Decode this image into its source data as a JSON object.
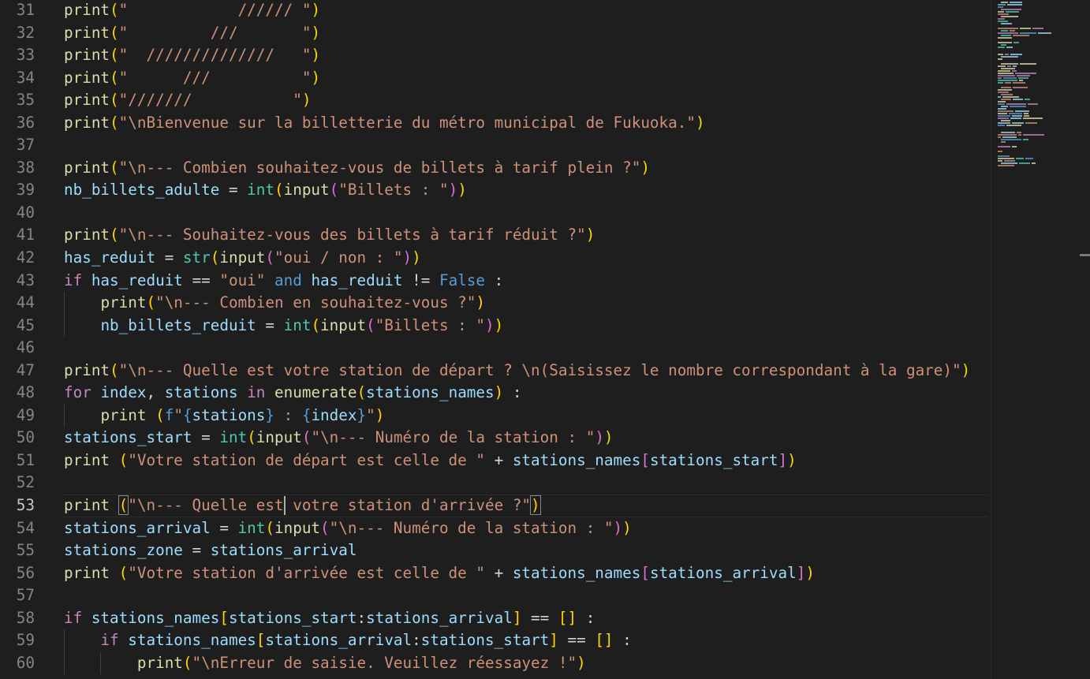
{
  "editor": {
    "current_line": 53,
    "lines": [
      {
        "n": "31",
        "tokens": [
          [
            "fn",
            "print"
          ],
          [
            "b1",
            "("
          ],
          [
            "str",
            "\"            ////// \""
          ],
          [
            "b1",
            ")"
          ]
        ]
      },
      {
        "n": "32",
        "tokens": [
          [
            "fn",
            "print"
          ],
          [
            "b1",
            "("
          ],
          [
            "str",
            "\"         ///       \""
          ],
          [
            "b1",
            ")"
          ]
        ]
      },
      {
        "n": "33",
        "tokens": [
          [
            "fn",
            "print"
          ],
          [
            "b1",
            "("
          ],
          [
            "str",
            "\"  //////////////   \""
          ],
          [
            "b1",
            ")"
          ]
        ]
      },
      {
        "n": "34",
        "tokens": [
          [
            "fn",
            "print"
          ],
          [
            "b1",
            "("
          ],
          [
            "str",
            "\"      ///          \""
          ],
          [
            "b1",
            ")"
          ]
        ]
      },
      {
        "n": "35",
        "tokens": [
          [
            "fn",
            "print"
          ],
          [
            "b1",
            "("
          ],
          [
            "str",
            "\"///////           \""
          ],
          [
            "b1",
            ")"
          ]
        ]
      },
      {
        "n": "36",
        "tokens": [
          [
            "fn",
            "print"
          ],
          [
            "b1",
            "("
          ],
          [
            "str",
            "\"\\nBienvenue sur la billetterie du métro municipal de Fukuoka.\""
          ],
          [
            "b1",
            ")"
          ]
        ]
      },
      {
        "n": "37",
        "tokens": []
      },
      {
        "n": "38",
        "tokens": [
          [
            "fn",
            "print"
          ],
          [
            "b1",
            "("
          ],
          [
            "str",
            "\"\\n--- Combien souhaitez-vous de billets à tarif plein ?\""
          ],
          [
            "b1",
            ")"
          ]
        ]
      },
      {
        "n": "39",
        "tokens": [
          [
            "var",
            "nb_billets_adulte"
          ],
          [
            "op",
            " = "
          ],
          [
            "type",
            "int"
          ],
          [
            "b1",
            "("
          ],
          [
            "fn",
            "input"
          ],
          [
            "b2",
            "("
          ],
          [
            "str",
            "\"Billets : \""
          ],
          [
            "b2",
            ")"
          ],
          [
            "b1",
            ")"
          ]
        ]
      },
      {
        "n": "40",
        "tokens": []
      },
      {
        "n": "41",
        "tokens": [
          [
            "fn",
            "print"
          ],
          [
            "b1",
            "("
          ],
          [
            "str",
            "\"\\n--- Souhaitez-vous des billets à tarif réduit ?\""
          ],
          [
            "b1",
            ")"
          ]
        ]
      },
      {
        "n": "42",
        "tokens": [
          [
            "var",
            "has_reduit"
          ],
          [
            "op",
            " = "
          ],
          [
            "type",
            "str"
          ],
          [
            "b1",
            "("
          ],
          [
            "fn",
            "input"
          ],
          [
            "b2",
            "("
          ],
          [
            "str",
            "\"oui / non : \""
          ],
          [
            "b2",
            ")"
          ],
          [
            "b1",
            ")"
          ]
        ]
      },
      {
        "n": "43",
        "tokens": [
          [
            "kw",
            "if"
          ],
          [
            "op",
            " "
          ],
          [
            "var",
            "has_reduit"
          ],
          [
            "op",
            " == "
          ],
          [
            "str",
            "\"oui\""
          ],
          [
            "op",
            " "
          ],
          [
            "const",
            "and"
          ],
          [
            "op",
            " "
          ],
          [
            "var",
            "has_reduit"
          ],
          [
            "op",
            " != "
          ],
          [
            "const",
            "False"
          ],
          [
            "op",
            " :"
          ]
        ]
      },
      {
        "n": "44",
        "tokens": [
          [
            "op",
            "    "
          ],
          [
            "fn",
            "print"
          ],
          [
            "b1",
            "("
          ],
          [
            "str",
            "\"\\n--- Combien en souhaitez-vous ?\""
          ],
          [
            "b1",
            ")"
          ]
        ]
      },
      {
        "n": "45",
        "tokens": [
          [
            "op",
            "    "
          ],
          [
            "var",
            "nb_billets_reduit"
          ],
          [
            "op",
            " = "
          ],
          [
            "type",
            "int"
          ],
          [
            "b1",
            "("
          ],
          [
            "fn",
            "input"
          ],
          [
            "b2",
            "("
          ],
          [
            "str",
            "\"Billets : \""
          ],
          [
            "b2",
            ")"
          ],
          [
            "b1",
            ")"
          ]
        ]
      },
      {
        "n": "46",
        "tokens": []
      },
      {
        "n": "47",
        "tokens": [
          [
            "fn",
            "print"
          ],
          [
            "b1",
            "("
          ],
          [
            "str",
            "\"\\n--- Quelle est votre station de départ ? \\n(Saisissez le nombre correspondant à la gare)\""
          ],
          [
            "b1",
            ")"
          ]
        ]
      },
      {
        "n": "48",
        "tokens": [
          [
            "kw",
            "for"
          ],
          [
            "op",
            " "
          ],
          [
            "var",
            "index"
          ],
          [
            "op",
            ", "
          ],
          [
            "var",
            "stations"
          ],
          [
            "op",
            " "
          ],
          [
            "kw",
            "in"
          ],
          [
            "op",
            " "
          ],
          [
            "fn",
            "enumerate"
          ],
          [
            "b1",
            "("
          ],
          [
            "var",
            "stations_names"
          ],
          [
            "b1",
            ")"
          ],
          [
            "op",
            " :"
          ]
        ]
      },
      {
        "n": "49",
        "tokens": [
          [
            "op",
            "    "
          ],
          [
            "fn",
            "print"
          ],
          [
            "op",
            " "
          ],
          [
            "b1",
            "("
          ],
          [
            "const",
            "f"
          ],
          [
            "str",
            "\""
          ],
          [
            "const",
            "{"
          ],
          [
            "var",
            "stations"
          ],
          [
            "const",
            "}"
          ],
          [
            "str",
            " : "
          ],
          [
            "const",
            "{"
          ],
          [
            "var",
            "index"
          ],
          [
            "const",
            "}"
          ],
          [
            "str",
            "\""
          ],
          [
            "b1",
            ")"
          ]
        ]
      },
      {
        "n": "50",
        "tokens": [
          [
            "var",
            "stations_start"
          ],
          [
            "op",
            " = "
          ],
          [
            "type",
            "int"
          ],
          [
            "b1",
            "("
          ],
          [
            "fn",
            "input"
          ],
          [
            "b2",
            "("
          ],
          [
            "str",
            "\"\\n--- Numéro de la station : \""
          ],
          [
            "b2",
            ")"
          ],
          [
            "b1",
            ")"
          ]
        ]
      },
      {
        "n": "51",
        "tokens": [
          [
            "fn",
            "print"
          ],
          [
            "op",
            " "
          ],
          [
            "b1",
            "("
          ],
          [
            "str",
            "\"Votre station de départ est celle de \""
          ],
          [
            "op",
            " + "
          ],
          [
            "var",
            "stations_names"
          ],
          [
            "b2",
            "["
          ],
          [
            "var",
            "stations_start"
          ],
          [
            "b2",
            "]"
          ],
          [
            "b1",
            ")"
          ]
        ]
      },
      {
        "n": "52",
        "tokens": []
      },
      {
        "n": "53",
        "tokens": [
          [
            "fn",
            "print"
          ],
          [
            "op",
            " "
          ],
          [
            "b1m",
            "("
          ],
          [
            "str",
            "\"\\n--- Quelle est votre station d'arrivée ?\""
          ],
          [
            "b1m",
            ")"
          ]
        ]
      },
      {
        "n": "54",
        "tokens": [
          [
            "var",
            "stations_arrival"
          ],
          [
            "op",
            " = "
          ],
          [
            "type",
            "int"
          ],
          [
            "b1",
            "("
          ],
          [
            "fn",
            "input"
          ],
          [
            "b2",
            "("
          ],
          [
            "str",
            "\"\\n--- Numéro de la station : \""
          ],
          [
            "b2",
            ")"
          ],
          [
            "b1",
            ")"
          ]
        ]
      },
      {
        "n": "55",
        "tokens": [
          [
            "var",
            "stations_zone"
          ],
          [
            "op",
            " = "
          ],
          [
            "var",
            "stations_arrival"
          ]
        ]
      },
      {
        "n": "56",
        "tokens": [
          [
            "fn",
            "print"
          ],
          [
            "op",
            " "
          ],
          [
            "b1",
            "("
          ],
          [
            "str",
            "\"Votre station d'arrivée est celle de \""
          ],
          [
            "op",
            " + "
          ],
          [
            "var",
            "stations_names"
          ],
          [
            "b2",
            "["
          ],
          [
            "var",
            "stations_arrival"
          ],
          [
            "b2",
            "]"
          ],
          [
            "b1",
            ")"
          ]
        ]
      },
      {
        "n": "57",
        "tokens": []
      },
      {
        "n": "58",
        "tokens": [
          [
            "kw",
            "if"
          ],
          [
            "op",
            " "
          ],
          [
            "var",
            "stations_names"
          ],
          [
            "b1",
            "["
          ],
          [
            "var",
            "stations_start"
          ],
          [
            "op",
            ":"
          ],
          [
            "var",
            "stations_arrival"
          ],
          [
            "b1",
            "]"
          ],
          [
            "op",
            " == "
          ],
          [
            "b1",
            "[]"
          ],
          [
            "op",
            " :"
          ]
        ]
      },
      {
        "n": "59",
        "tokens": [
          [
            "op",
            "    "
          ],
          [
            "kw",
            "if"
          ],
          [
            "op",
            " "
          ],
          [
            "var",
            "stations_names"
          ],
          [
            "b1",
            "["
          ],
          [
            "var",
            "stations_arrival"
          ],
          [
            "op",
            ":"
          ],
          [
            "var",
            "stations_start"
          ],
          [
            "b1",
            "]"
          ],
          [
            "op",
            " == "
          ],
          [
            "b1",
            "[]"
          ],
          [
            "op",
            " :"
          ]
        ]
      },
      {
        "n": "60",
        "tokens": [
          [
            "op",
            "        "
          ],
          [
            "fn",
            "print"
          ],
          [
            "b1",
            "("
          ],
          [
            "str",
            "\"\\nErreur de saisie. Veuillez réessayez !\""
          ],
          [
            "b1",
            ")"
          ]
        ]
      }
    ]
  },
  "colors": {
    "background": "#1e1e1e",
    "function": "#dcdcaa",
    "string": "#ce9178",
    "variable": "#9cdcfe",
    "builtin_type": "#4ec9b0",
    "control_keyword": "#c586c0",
    "constant": "#569cd6",
    "bracket_level1": "#ffd700",
    "bracket_level2": "#da70d6",
    "line_number": "#858585"
  }
}
